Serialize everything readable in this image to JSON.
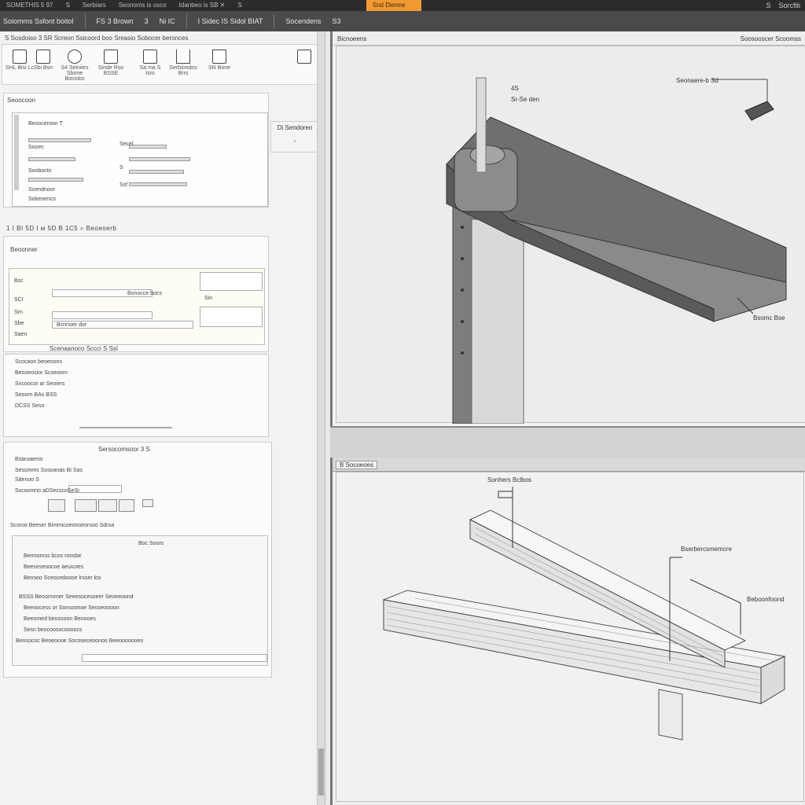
{
  "titlebar": {
    "tabs": [
      "SOMETHIS 5 97",
      "S",
      "Serbiars",
      "Seonoms is osco",
      "Idanbeo is SB ✕",
      "S"
    ],
    "active_tab": "Snd Dienne",
    "right": [
      "S",
      "Sorcfiti"
    ]
  },
  "toolbar": {
    "items": [
      "Soiomms Ssfont boitol",
      "FS 3 Brown",
      "3",
      "Ni IC",
      "I Sidec IS Sidol BIAT",
      "Socendens",
      "S3"
    ]
  },
  "left": {
    "header": "S Sosdoiso 3 SR  Screon Ssicoord boo Sreasio Sobocer beronces",
    "ribbon": [
      {
        "label": "SHL\nBisi Lc"
      },
      {
        "label": "Sbi\nBsn"
      },
      {
        "label": "S4 Seiniies\nSbone Bisnobs"
      },
      {
        "label": "Sinde Rso\nBSSE"
      },
      {
        "label": "Sa ma\nS Isro"
      },
      {
        "label": "Serbiondos\nBrrs"
      },
      {
        "label": "SN Bone"
      }
    ],
    "strip_label": "Di Sendoren",
    "panel1": {
      "title": "Seoocoon",
      "rows": [
        "Beoocenoor T",
        "Sooec",
        "Sooboctn ",
        "Scendnoor",
        "Secel",
        "S",
        "Ssf",
        "Sobeoencs"
      ]
    },
    "search_row": "1  I  BI 5D  I  ᴍ 5D  B 1C5  ⌕ Beoeoerb",
    "panel2": {
      "title": "Beoonner",
      "rows": [
        "Bsc",
        "SCI",
        "Srn",
        "Sbe",
        "Saen",
        "Bonocce bocs",
        "Bcnnoer dor",
        "Sin"
      ],
      "footer": "Scenaanoco  Sccci S  SsI"
    },
    "list1": [
      "Scocaon beoeoons",
      "Beooeosior Scoeoom",
      "Sncoocor ar Seoiers",
      "Seoorn  BAs BSS",
      "DCSS Seso"
    ],
    "panel3": {
      "title": "Sersocomsoor 3 S",
      "rows": [
        "Bsaroaems",
        "Sessmms   Sosoanas Bi Sas",
        "Sdenoo S",
        "Sscoomno aDSecscoSeSr"
      ],
      "subtitle": "Scsroo  Beeser  Bimmicoeonoeorsoo Sdroa",
      "items": [
        "Bermomss bcos  ronsbe",
        "Beeceseoocoe aeuicoes",
        "Beosoo Sceocedoooe  lrsser los",
        "BSSS  Beoormmer Seeesocesoeer  Seoeeoond",
        "Beeoocess  or Sonsoonoe  Seooeoooon",
        "Beeomed beossoon  Beoooes",
        "Sesn beocoosocoooocs",
        "Beosococ Beoeoooe  Socoseceoonoo  Beeooooooeo"
      ],
      "right_label": "Boc Soors"
    }
  },
  "viewport_top": {
    "header": "Bicnoeens",
    "header_right": "Soosooscer  Scoomss",
    "label_top": "Seonaere-b Sd",
    "label_pin": "Sr-Se den",
    "label_bottom": "Bsomc  Bse",
    "label_num": "4S"
  },
  "viewport_bottom": {
    "header": "B Socoeoes",
    "label_top": "Sonhers Bclbos",
    "label_right1": "Bserbercsmemcre",
    "label_right2": "Beboonfoond"
  }
}
